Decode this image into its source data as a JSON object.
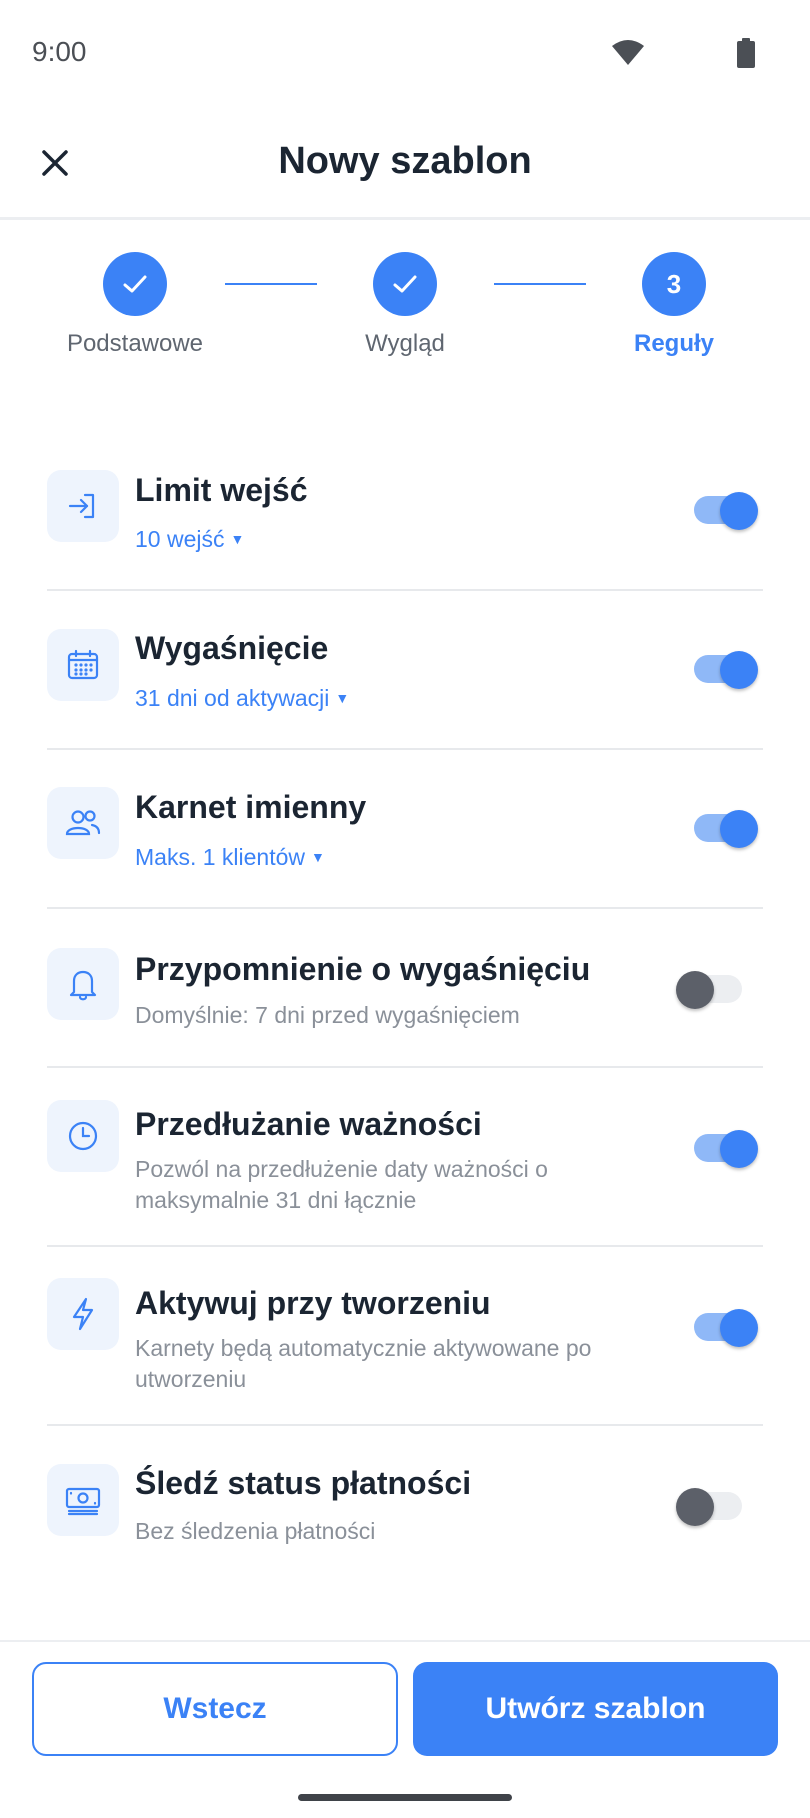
{
  "status_bar": {
    "time": "9:00"
  },
  "header": {
    "title": "Nowy szablon"
  },
  "stepper": {
    "steps": [
      {
        "label": "Podstawowe",
        "state": "done"
      },
      {
        "label": "Wygląd",
        "state": "done"
      },
      {
        "label": "Reguły",
        "number": "3",
        "state": "active"
      }
    ]
  },
  "rules": [
    {
      "title": "Limit wejść",
      "subtitle": "10 wejść",
      "subtitle_dropdown": true,
      "enabled": true,
      "icon": "login-icon"
    },
    {
      "title": "Wygaśnięcie",
      "subtitle": "31 dni od aktywacji",
      "subtitle_dropdown": true,
      "enabled": true,
      "icon": "calendar-icon"
    },
    {
      "title": "Karnet imienny",
      "subtitle": "Maks. 1 klientów",
      "subtitle_dropdown": true,
      "enabled": true,
      "icon": "users-icon"
    },
    {
      "title": "Przypomnienie o wygaśnięciu",
      "description": "Domyślnie: 7 dni przed wygaśnięciem",
      "enabled": false,
      "icon": "bell-icon"
    },
    {
      "title": "Przedłużanie ważności",
      "description": "Pozwól na przedłużenie daty ważności o maksymalnie 31 dni łącznie",
      "enabled": true,
      "icon": "clock-icon"
    },
    {
      "title": "Aktywuj przy tworzeniu",
      "description": "Karnety będą automatycznie aktywowane po utworzeniu",
      "enabled": true,
      "icon": "lightning-icon"
    },
    {
      "title": "Śledź status płatności",
      "description": "Bez śledzenia płatności",
      "enabled": false,
      "icon": "banknote-icon"
    }
  ],
  "footer": {
    "back_label": "Wstecz",
    "create_label": "Utwórz szablon"
  },
  "colors": {
    "accent": "#3b82f6",
    "icon_bg": "#eef4fd",
    "title": "#1b2532",
    "muted": "#8a9099"
  }
}
